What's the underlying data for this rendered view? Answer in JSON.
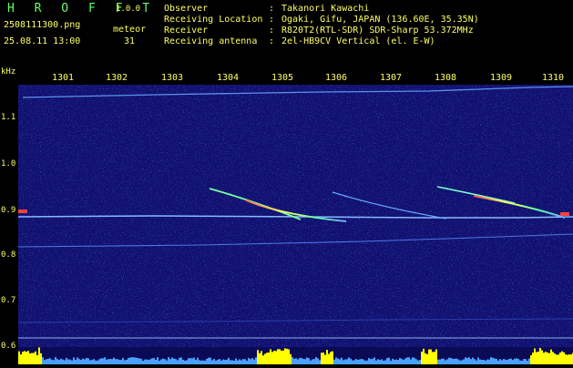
{
  "app": {
    "title": "H R O F F T",
    "version": "1.0.0"
  },
  "file": {
    "name": "2508111300.png",
    "datetime": "25.08.11 13:00"
  },
  "meteor": {
    "label": "meteor",
    "count": "31"
  },
  "meta": [
    {
      "key": "Observer",
      "value": "Takanori Kawachi"
    },
    {
      "key": "Receiving Location",
      "value": "Ogaki, Gifu, JAPAN (136.60E, 35.35N)"
    },
    {
      "key": "Receiver",
      "value": "R820T2(RTL-SDR) SDR-Sharp 53.372MHz"
    },
    {
      "key": "Receiving antenna",
      "value": "2el-HB9CV Vertical (el. E-W)"
    }
  ],
  "axis": {
    "y_unit": "kHz",
    "x_ticks": [
      "1301",
      "1302",
      "1303",
      "1304",
      "1305",
      "1306",
      "1307",
      "1308",
      "1309",
      "1310"
    ],
    "y_ticks": [
      "1.1",
      "1.0",
      "0.9",
      "0.8",
      "0.7",
      "0.6"
    ]
  },
  "colors": {
    "background": "#000000",
    "spectrogram": "#10106e",
    "label_yellow": "#ffff66",
    "title_green": "#66ff66",
    "trace": "#6aa8ff",
    "signal_hot": "#ff4040",
    "bar_yellow": "#ffff00"
  }
}
